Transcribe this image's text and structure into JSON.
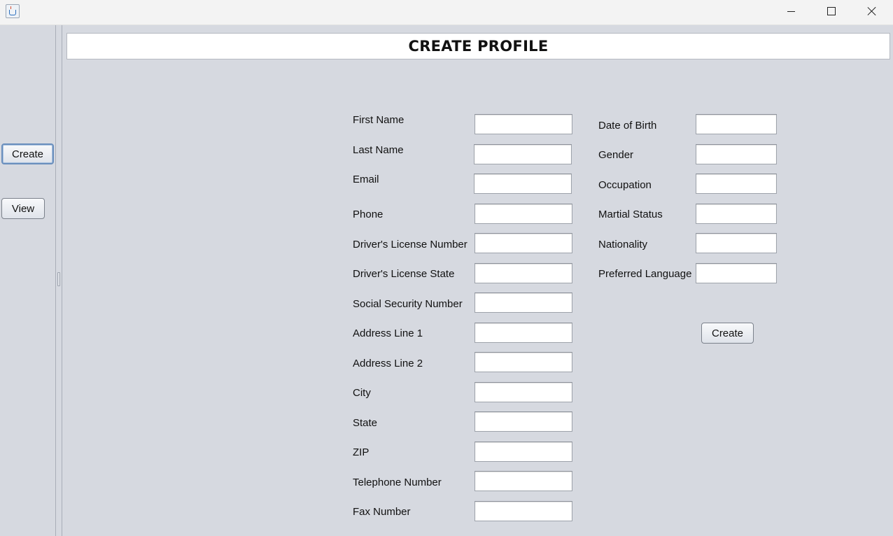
{
  "window": {
    "app_icon": "java-cup-icon",
    "controls": {
      "minimize": "minimize-icon",
      "maximize": "maximize-icon",
      "close": "close-icon"
    }
  },
  "sidebar": {
    "create_label": "Create",
    "view_label": "View"
  },
  "header": {
    "title": "CREATE PROFILE"
  },
  "form": {
    "left_fields": [
      {
        "label": "First Name",
        "value": ""
      },
      {
        "label": "Last Name",
        "value": ""
      },
      {
        "label": "Email",
        "value": ""
      },
      {
        "label": "Phone",
        "value": ""
      },
      {
        "label": "Driver's License Number",
        "value": ""
      },
      {
        "label": "Driver's License State",
        "value": ""
      },
      {
        "label": "Social Security Number",
        "value": ""
      },
      {
        "label": "Address Line 1",
        "value": ""
      },
      {
        "label": "Address Line 2",
        "value": ""
      },
      {
        "label": "City",
        "value": ""
      },
      {
        "label": "State",
        "value": ""
      },
      {
        "label": "ZIP",
        "value": ""
      },
      {
        "label": "Telephone Number",
        "value": ""
      },
      {
        "label": "Fax Number",
        "value": ""
      }
    ],
    "right_fields": [
      {
        "label": "Date of Birth",
        "value": ""
      },
      {
        "label": "Gender",
        "value": ""
      },
      {
        "label": "Occupation",
        "value": ""
      },
      {
        "label": "Martial Status",
        "value": ""
      },
      {
        "label": "Nationality",
        "value": ""
      },
      {
        "label": "Preferred Language",
        "value": ""
      }
    ],
    "submit_label": "Create"
  }
}
